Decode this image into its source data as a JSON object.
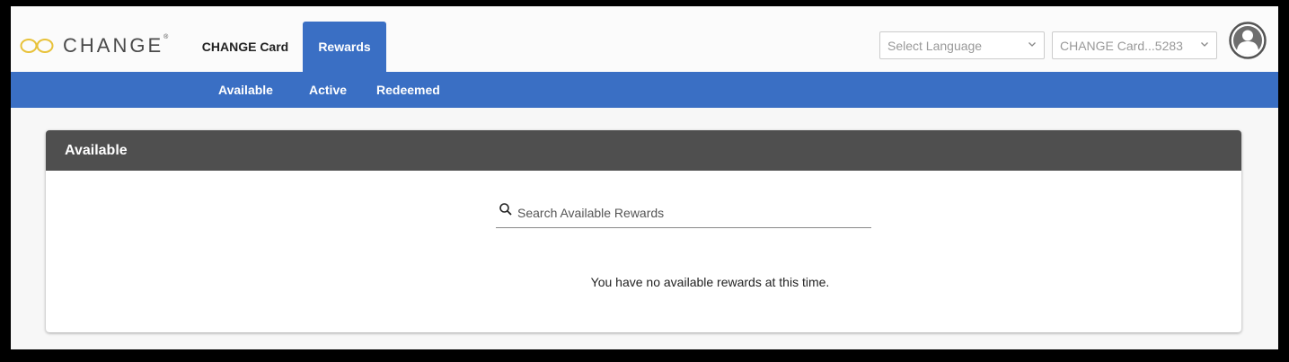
{
  "brand": {
    "name": "CHANGE",
    "trademark": "®"
  },
  "header": {
    "tabs": [
      {
        "label": "CHANGE Card",
        "selected": false
      },
      {
        "label": "Rewards",
        "selected": true
      }
    ],
    "language_select": {
      "value": "Select Language"
    },
    "card_select": {
      "value": "CHANGE Card...5283"
    }
  },
  "subnav": {
    "items": [
      {
        "label": "Available",
        "selected": true
      },
      {
        "label": "Active",
        "selected": false
      },
      {
        "label": "Redeemed",
        "selected": false
      }
    ]
  },
  "panel": {
    "title": "Available",
    "search_placeholder": "Search Available Rewards",
    "empty_message": "You have no available rewards at this time."
  },
  "colors": {
    "accent": "#3a6fc4",
    "panel_header": "#4f4f4f",
    "logo_gold": "#e8c23a"
  },
  "icons": [
    "infinity-logo-icon",
    "chevron-down-icon",
    "user-avatar-icon",
    "search-icon"
  ]
}
